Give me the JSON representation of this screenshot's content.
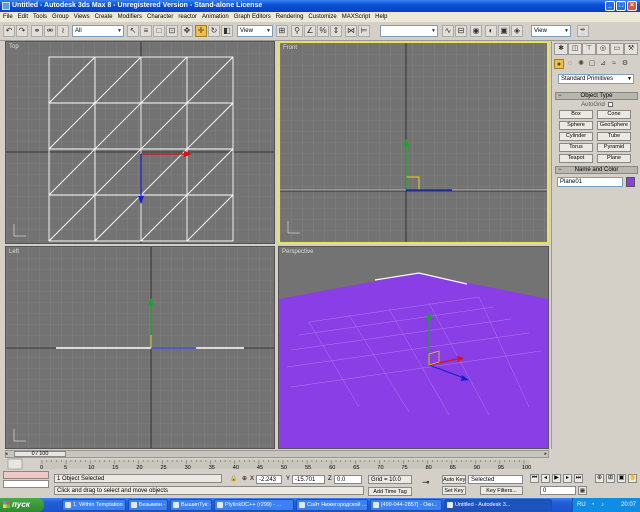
{
  "window": {
    "title": "Untitled - Autodesk 3ds Max 8 - Unregistered Version - Stand-alone License"
  },
  "menu": [
    "File",
    "Edit",
    "Tools",
    "Group",
    "Views",
    "Create",
    "Modifiers",
    "Character",
    "reactor",
    "Animation",
    "Graph Editors",
    "Rendering",
    "Customize",
    "MAXScript",
    "Help"
  ],
  "toolbar": {
    "selection_filter": "All",
    "ref_coord": "View",
    "named_selection": "",
    "render_type": "View"
  },
  "viewports": {
    "top": "Top",
    "front": "Front",
    "left": "Left",
    "perspective": "Perspective"
  },
  "command_panel": {
    "category": "Standard Primitives",
    "object_type_title": "Object Type",
    "autogrid": "AutoGrid",
    "primitives": [
      "Box",
      "Cone",
      "Sphere",
      "GeoSphere",
      "Cylinder",
      "Tube",
      "Torus",
      "Pyramid",
      "Teapot",
      "Plane"
    ],
    "name_color_title": "Name and Color",
    "object_name": "Plane01",
    "object_color": "#8a3ee6"
  },
  "time": {
    "slider_label": "0 / 100",
    "ticks": [
      "0",
      "5",
      "10",
      "15",
      "20",
      "25",
      "30",
      "35",
      "40",
      "45",
      "50",
      "55",
      "60",
      "65",
      "70",
      "75",
      "80",
      "85",
      "90",
      "95",
      "100"
    ]
  },
  "status": {
    "selection": "1 Object Selected",
    "prompt": "Click and drag to select and move objects",
    "x_value": "-2.243",
    "y_value": "-15.701",
    "z_value": "0.0",
    "grid": "Grid = 10.0",
    "add_time_tag": "Add Time Tag",
    "auto_key": "Auto Key",
    "set_key": "Set Key",
    "key_mode": "Selected",
    "key_filters": "Key Filters...",
    "frame": "0"
  },
  "taskbar": {
    "start": "пуск",
    "tasks": [
      "1. Within Temptation ...",
      "Безымян - ...",
      "ВышипТук: 44",
      "PlyIinkDC++ (r299) - ...",
      "Сайт Нижегородской ...",
      "[499-044-2857] - Окн...",
      "Untitled - Autodesk 3..."
    ],
    "lang": "RU",
    "clock": "20:07"
  },
  "colors": {
    "active_border": "#e8e060",
    "viewport_bg": "#737373",
    "perspective_plane": "#8a3ee6"
  }
}
